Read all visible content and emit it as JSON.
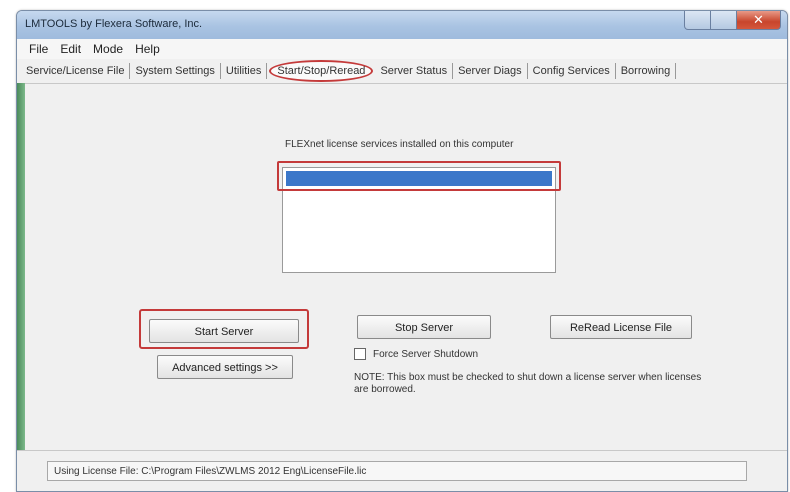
{
  "window": {
    "title": "LMTOOLS by Flexera Software, Inc."
  },
  "menu": [
    "File",
    "Edit",
    "Mode",
    "Help"
  ],
  "tabs": [
    {
      "label": "Service/License File"
    },
    {
      "label": "System Settings"
    },
    {
      "label": "Utilities"
    },
    {
      "label": "Start/Stop/Reread",
      "active": true
    },
    {
      "label": "Server Status"
    },
    {
      "label": "Server Diags"
    },
    {
      "label": "Config Services"
    },
    {
      "label": "Borrowing"
    }
  ],
  "main": {
    "installed_label": "FLEXnet license services installed on this computer",
    "services_list": [
      ""
    ]
  },
  "buttons": {
    "start": "Start Server",
    "stop": "Stop Server",
    "reread": "ReRead License File",
    "advanced": "Advanced settings >>"
  },
  "force_shutdown": {
    "label": "Force Server Shutdown",
    "checked": false
  },
  "note": "NOTE:  This box must be checked to shut down a license server when licenses are borrowed.",
  "status": {
    "license_file": "Using License File:  C:\\Program Files\\ZWLMS 2012 Eng\\LicenseFile.lic"
  },
  "colors": {
    "highlight_annotation": "#c43a3a",
    "selection": "#3b77c9",
    "titlebar": "#a9c3e2"
  }
}
